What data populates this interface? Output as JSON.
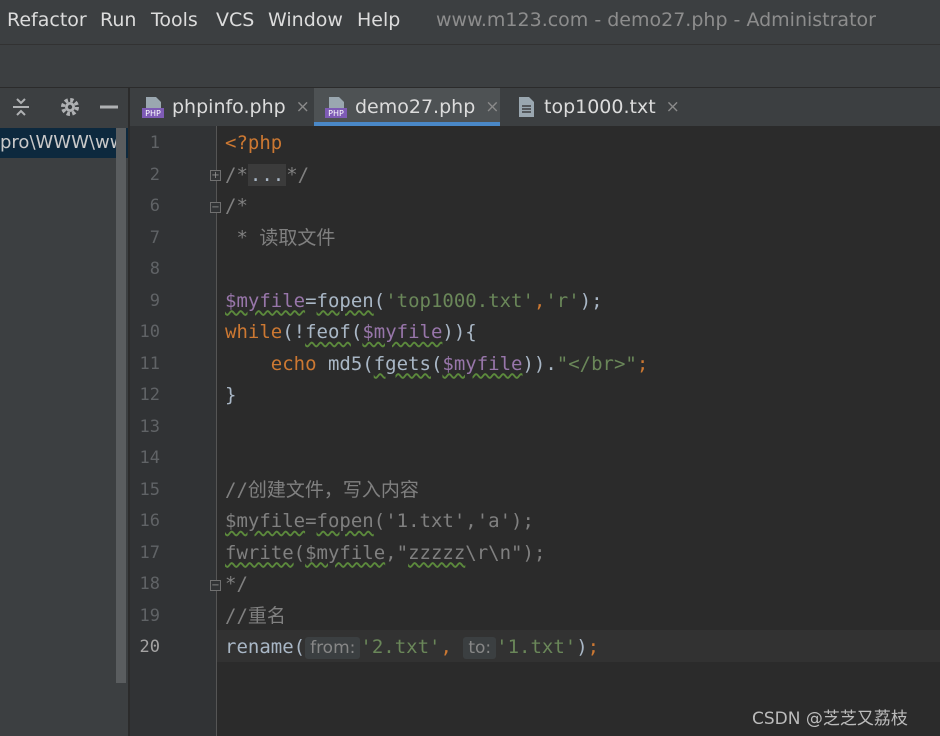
{
  "menu": {
    "items": [
      {
        "label": "Refactor"
      },
      {
        "label": "Run"
      },
      {
        "label": "Tools"
      },
      {
        "label": "VCS"
      },
      {
        "label": "Window"
      },
      {
        "label": "Help"
      }
    ],
    "window_title": "www.m123.com - demo27.php - Administrator"
  },
  "project_panel": {
    "icons": [
      "collapse-all-icon",
      "gear-icon",
      "minimize-icon"
    ],
    "path_text": "pro\\WWW\\ww"
  },
  "tabs": [
    {
      "label": "phpinfo.php",
      "icon": "php-file-icon",
      "active": false
    },
    {
      "label": "demo27.php",
      "icon": "php-file-icon",
      "active": true
    },
    {
      "label": "top1000.txt",
      "icon": "text-file-icon",
      "active": false
    }
  ],
  "tab_close_glyph": "×",
  "editor": {
    "line_numbers": [
      "1",
      "2",
      "6",
      "7",
      "8",
      "9",
      "10",
      "11",
      "12",
      "13",
      "14",
      "15",
      "16",
      "17",
      "18",
      "19",
      "20"
    ],
    "current_line": "20",
    "lines": {
      "l1": "<?php",
      "l2_a": "/*",
      "l2_b": "...",
      "l2_c": "*/",
      "l6": "/*",
      "l7": " * 读取文件",
      "l9_var": "$myfile",
      "l9_eq": "=",
      "l9_fn": "fopen",
      "l9_a": "(",
      "l9_s1": "'top1000.txt'",
      "l9_c": ",",
      "l9_s2": "'r'",
      "l9_e": ");",
      "l10_kw": "while",
      "l10_a": "(!",
      "l10_fn": "feof",
      "l10_b": "(",
      "l10_var": "$myfile",
      "l10_c": ")){",
      "l11_kw": "    echo ",
      "l11_fn": "md5",
      "l11_a": "(",
      "l11_fn2": "fgets",
      "l11_b": "(",
      "l11_var": "$myfile",
      "l11_c": ")).",
      "l11_s": "\"</br>\"",
      "l11_e": ";",
      "l12": "}",
      "l15": "//创建文件，写入内容",
      "l16_var": "$myfile",
      "l16_eq": "=",
      "l16_fn": "fopen",
      "l16_a": "(",
      "l16_s1": "'1.txt'",
      "l16_c": ",",
      "l16_s2": "'a'",
      "l16_e": ");",
      "l17_fn": "fwrite",
      "l17_a": "(",
      "l17_var": "$myfile",
      "l17_c": ",",
      "l17_s1": "\"",
      "l17_s2": "zzzzz",
      "l17_s3": "\\r\\n",
      "l17_s4": "\"",
      "l17_e": ");",
      "l18": "*/",
      "l19": "//重名",
      "l20_fn": "rename(",
      "l20_h1": "from:",
      "l20_s1": "'2.txt'",
      "l20_c": ", ",
      "l20_h2": "to:",
      "l20_s2": "'1.txt'",
      "l20_e": ")",
      "l20_semi": ";"
    }
  },
  "watermark": "CSDN @芝芝又荔枝",
  "colors": {
    "keyword": "#cc7832",
    "string": "#6a8759",
    "comment": "#808080",
    "variable": "#9876aa",
    "tab_accent": "#4a88c7"
  }
}
